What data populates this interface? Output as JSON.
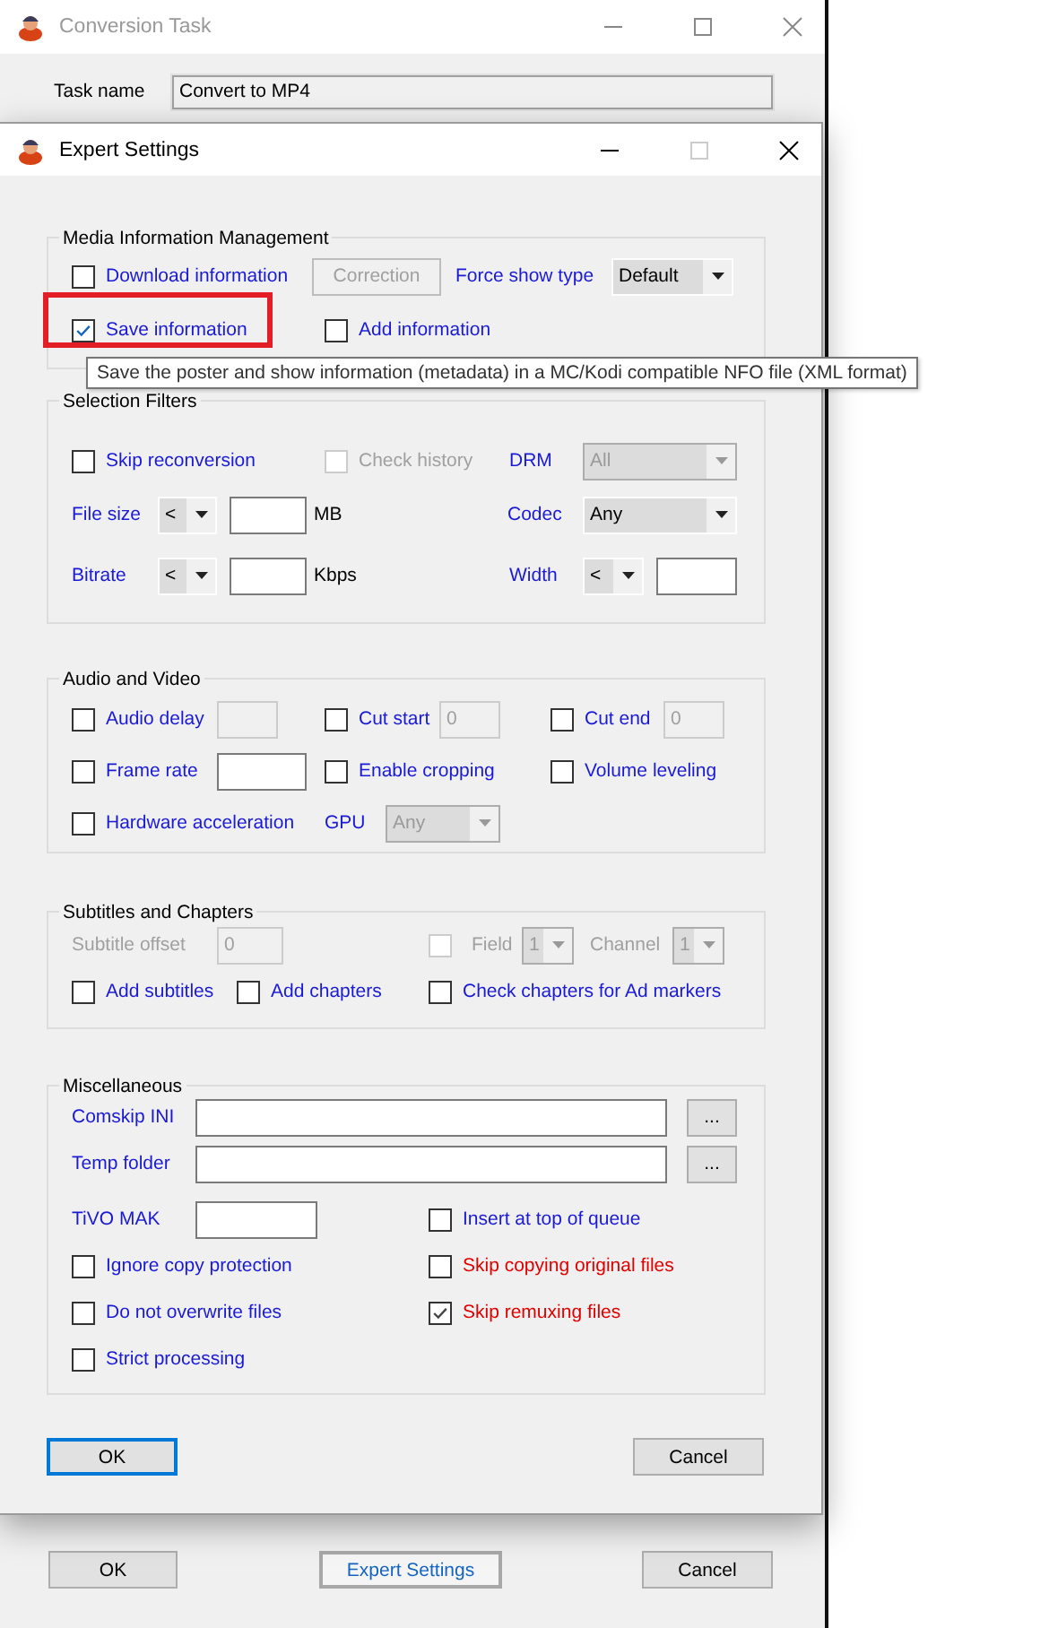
{
  "main_window": {
    "title": "Conversion Task",
    "task_name_label": "Task name",
    "task_name": "Convert to MP4",
    "buttons": [
      {
        "label": "OK",
        "kind": "plain"
      },
      {
        "label": "Expert Settings",
        "kind": "accent"
      },
      {
        "label": "Cancel",
        "kind": "plain"
      }
    ]
  },
  "dialog": {
    "title": "Expert Settings",
    "groups": [
      {
        "title": "Media Information Management",
        "rows": [
          [
            {
              "kind": "checkbox",
              "label": "Download information",
              "checked": false,
              "disabled": false
            },
            {
              "kind": "button",
              "label": "Correction",
              "disabled": true
            },
            {
              "kind": "label",
              "text": "Force show type",
              "disabled": false
            },
            {
              "kind": "combo",
              "value": "Default",
              "disabled": false
            }
          ],
          [
            {
              "kind": "checkbox",
              "label": "Save information",
              "checked": true,
              "disabled": false,
              "highlighted": true
            },
            {
              "kind": "checkbox",
              "label": "Add information",
              "checked": false,
              "disabled": false
            }
          ]
        ]
      },
      {
        "title": "Selection Filters",
        "rows": [
          [
            {
              "kind": "checkbox",
              "label": "Skip reconversion",
              "checked": false,
              "disabled": false
            },
            "",
            "",
            {
              "kind": "checkbox",
              "label": "Check history",
              "checked": false,
              "disabled": true
            },
            {
              "kind": "label",
              "text": "DRM",
              "disabled": false
            },
            {
              "kind": "combo",
              "value": "All",
              "disabled": true
            }
          ],
          [
            {
              "kind": "label",
              "text": "File size",
              "disabled": false
            },
            {
              "kind": "combo",
              "value": "<",
              "disabled": false
            },
            {
              "kind": "textbox",
              "disabled": false
            },
            {
              "kind": "unit",
              "text": "MB"
            },
            {
              "kind": "label",
              "text": "Codec",
              "disabled": false
            },
            {
              "kind": "combo",
              "value": "Any",
              "disabled": false
            }
          ],
          [
            {
              "kind": "label",
              "text": "Bitrate",
              "disabled": false
            },
            {
              "kind": "combo",
              "value": "<",
              "disabled": false
            },
            {
              "kind": "textbox",
              "disabled": false
            },
            {
              "kind": "unit",
              "text": "Kbps"
            },
            {
              "kind": "label",
              "text": "Width",
              "disabled": false
            },
            {
              "kind": "combo",
              "value": "<",
              "disabled": false
            },
            {
              "kind": "textbox",
              "disabled": false
            }
          ]
        ]
      },
      {
        "title": "Audio and Video",
        "rows": [
          [
            {
              "kind": "checkbox",
              "label": "Audio delay",
              "checked": false,
              "disabled": false
            },
            {
              "kind": "textbox",
              "disabled": true
            },
            {
              "kind": "checkbox",
              "label": "Cut start",
              "checked": false,
              "disabled": false
            },
            {
              "kind": "textbox",
              "value": "0",
              "disabled": true
            },
            {
              "kind": "checkbox",
              "label": "Cut end",
              "checked": false,
              "disabled": false
            },
            {
              "kind": "textbox",
              "value": "0",
              "disabled": true
            }
          ],
          [
            {
              "kind": "checkbox",
              "label": "Frame rate",
              "checked": false,
              "disabled": false
            },
            {
              "kind": "textbox",
              "disabled": false
            },
            {
              "kind": "checkbox",
              "label": "Enable cropping",
              "checked": false,
              "disabled": false
            },
            "",
            {
              "kind": "checkbox",
              "label": "Volume leveling",
              "checked": false,
              "disabled": false
            }
          ],
          [
            {
              "kind": "checkbox",
              "label": "Hardware acceleration",
              "checked": false,
              "disabled": false
            },
            "",
            {
              "kind": "combo",
              "label": "GPU",
              "value": "Any",
              "disabled": true
            }
          ]
        ]
      },
      {
        "title": "Subtitles and Chapters",
        "rows": [
          [
            {
              "kind": "label",
              "text": "Subtitle offset",
              "disabled": true
            },
            {
              "kind": "textbox",
              "value": "0",
              "disabled": true
            },
            {
              "kind": "checkbox",
              "checked": false,
              "disabled": true
            },
            {
              "kind": "label",
              "text": "Field",
              "disabled": true
            },
            {
              "kind": "combo",
              "value": "1",
              "disabled": true
            },
            {
              "kind": "label",
              "text": "Channel",
              "disabled": true
            },
            {
              "kind": "combo",
              "value": "1",
              "disabled": true
            }
          ],
          [
            {
              "kind": "checkbox",
              "label": "Add subtitles",
              "checked": false,
              "disabled": false
            },
            {
              "kind": "checkbox",
              "label": "Add chapters",
              "checked": false,
              "disabled": false
            },
            {
              "kind": "checkbox",
              "label": "Check chapters for Ad markers",
              "checked": false,
              "disabled": false
            }
          ]
        ]
      },
      {
        "title": "Miscellaneous",
        "rows": [
          [
            {
              "kind": "label",
              "text": "Comskip INI",
              "disabled": false
            },
            {
              "kind": "textbox",
              "disabled": false
            },
            {
              "kind": "button",
              "label": "...",
              "disabled": false
            }
          ],
          [
            {
              "kind": "label",
              "text": "Temp folder",
              "disabled": false
            },
            {
              "kind": "textbox",
              "disabled": false
            },
            {
              "kind": "button",
              "label": "...",
              "disabled": false
            }
          ],
          [
            {
              "kind": "label",
              "text": "TiVO MAK",
              "disabled": false
            },
            {
              "kind": "textbox",
              "disabled": false
            },
            {
              "kind": "checkbox",
              "label": "Insert at top of queue",
              "checked": false,
              "disabled": false
            }
          ],
          [
            {
              "kind": "checkbox",
              "label": "Ignore copy protection",
              "checked": false,
              "disabled": false
            },
            "",
            {
              "kind": "checkbox",
              "label": "Skip copying original files",
              "checked": false,
              "disabled": false,
              "color": "#e00000"
            }
          ],
          [
            {
              "kind": "checkbox",
              "label": "Do not overwrite files",
              "checked": false,
              "disabled": false
            },
            "",
            {
              "kind": "checkbox",
              "label": "Skip remuxing files",
              "checked": true,
              "disabled": false,
              "color": "#e00000"
            }
          ],
          [
            {
              "kind": "checkbox",
              "label": "Strict processing",
              "checked": false,
              "disabled": false
            }
          ]
        ]
      }
    ],
    "buttons": [
      {
        "label": "OK",
        "kind": "focused"
      },
      {
        "label": "Cancel",
        "kind": "plain"
      }
    ]
  },
  "tooltip": {
    "text": "Save the poster and show information (metadata) in a MC/Kodi compatible NFO file (XML format)"
  }
}
